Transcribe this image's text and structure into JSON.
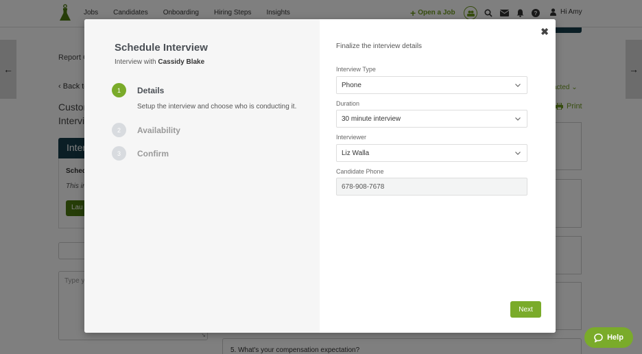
{
  "header": {
    "nav": [
      "Jobs",
      "Candidates",
      "Onboarding",
      "Hiring Steps",
      "Insights"
    ],
    "open_job": "Open a Job",
    "greeting": "Hi Amy",
    "icons": [
      "team-icon",
      "search-icon",
      "envelope-icon",
      "bell-icon",
      "help-circle-icon",
      "user-icon"
    ]
  },
  "background": {
    "report_link": "Report C",
    "back_link": "Back to",
    "title_line1": "Custor",
    "title_line2": "Intervi",
    "card_title": "Inter",
    "schedule_label": "Sched",
    "this_label": "This in",
    "launch_label": "Lau",
    "textarea_placeholder": "Type y",
    "status_label": "acted",
    "print_label": "Print",
    "question": "5.  What's your compensation expectation?"
  },
  "modal": {
    "title": "Schedule Interview",
    "subtitle_prefix": "Interview with ",
    "candidate_name": "Cassidy Blake",
    "steps": [
      {
        "number": "1",
        "label": "Details",
        "description": "Setup the interview and choose who is conducting it."
      },
      {
        "number": "2",
        "label": "Availability"
      },
      {
        "number": "3",
        "label": "Confirm"
      }
    ],
    "right_heading": "Finalize the interview details",
    "fields": {
      "interview_type": {
        "label": "Interview Type",
        "value": "Phone"
      },
      "duration": {
        "label": "Duration",
        "value": "30 minute interview"
      },
      "interviewer": {
        "label": "Interviewer",
        "value": "Liz Walla"
      },
      "candidate_phone": {
        "label": "Candidate Phone",
        "value": "678-908-7678"
      }
    },
    "next_label": "Next"
  },
  "help": {
    "label": "Help"
  },
  "colors": {
    "accent": "#7aab2a",
    "dark_teal": "#173c4a",
    "nav_green": "#6f9a1f"
  }
}
